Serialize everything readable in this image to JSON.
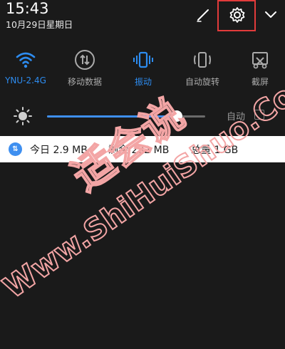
{
  "status": {
    "time": "15:43",
    "date": "10月29日星期日"
  },
  "toggles": [
    {
      "label": "YNU-2.4G",
      "icon": "wifi-icon",
      "active": true
    },
    {
      "label": "移动数据",
      "icon": "mobile-data-icon",
      "active": false
    },
    {
      "label": "振动",
      "icon": "vibrate-icon",
      "active": true
    },
    {
      "label": "自动旋转",
      "icon": "auto-rotate-icon",
      "active": false
    },
    {
      "label": "截屏",
      "icon": "screenshot-icon",
      "active": false
    }
  ],
  "brightness": {
    "level": 0.82,
    "auto_label": "自动",
    "auto_checked": false
  },
  "data_usage": {
    "today": "今日 2.9 MB",
    "remaining": "剩余 232 MB",
    "total": "总量 1 GB"
  },
  "watermark": {
    "text_cn": "适会说",
    "text_en": "Www.ShiHuiShuo.Com"
  },
  "colors": {
    "accent": "#2d8cf0",
    "highlight": "#e23b3b",
    "background": "#1a1a1a"
  }
}
